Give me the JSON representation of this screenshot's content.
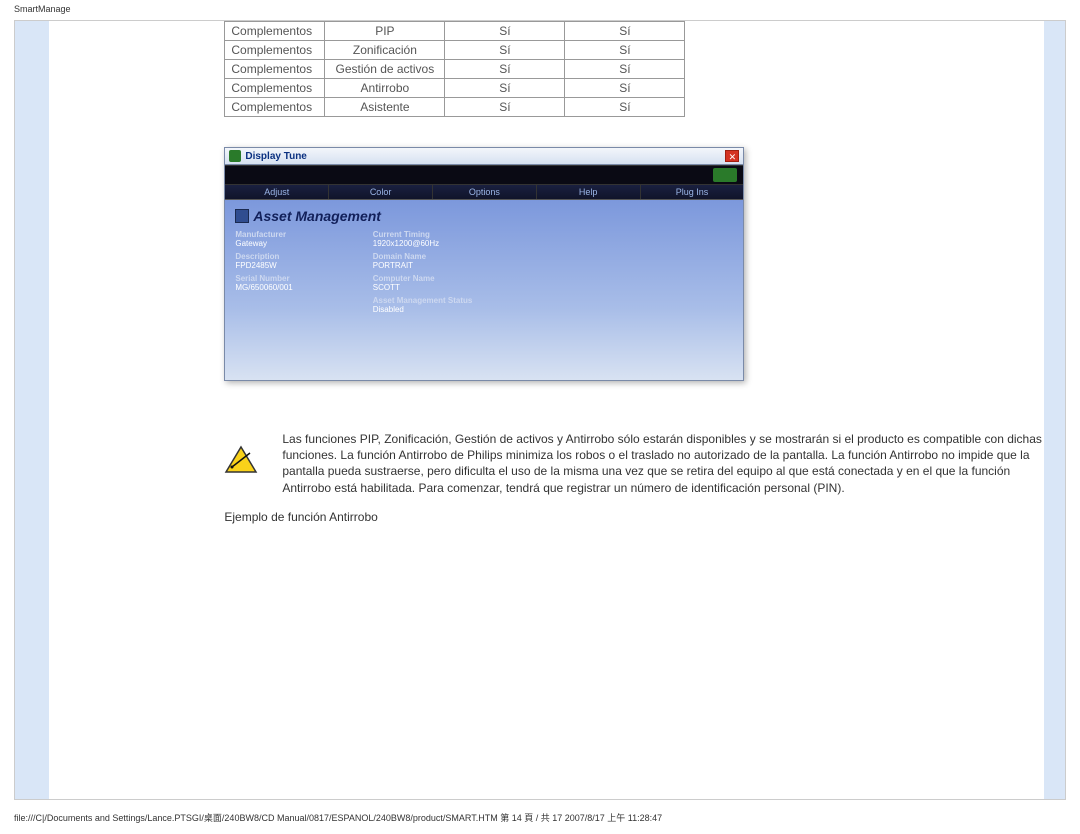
{
  "page_title": "SmartManage",
  "table": {
    "rows": [
      {
        "c1": "Complementos",
        "c2": "PIP",
        "c3": "Sí",
        "c4": "Sí"
      },
      {
        "c1": "Complementos",
        "c2": "Zonificación",
        "c3": "Sí",
        "c4": "Sí"
      },
      {
        "c1": "Complementos",
        "c2": "Gestión de activos",
        "c3": "Sí",
        "c4": "Sí"
      },
      {
        "c1": "Complementos",
        "c2": "Antirrobo",
        "c3": "Sí",
        "c4": "Sí"
      },
      {
        "c1": "Complementos",
        "c2": "Asistente",
        "c3": "Sí",
        "c4": "Sí"
      }
    ]
  },
  "display_tune": {
    "title": "Display Tune",
    "tabs": [
      "Adjust",
      "Color",
      "Options",
      "Help",
      "Plug Ins"
    ],
    "header": "Asset Management",
    "left": [
      {
        "label": "Manufacturer",
        "value": "Gateway"
      },
      {
        "label": "Description",
        "value": "FPD2485W"
      },
      {
        "label": "Serial Number",
        "value": "MG/650060/001"
      }
    ],
    "right": [
      {
        "label": "Current Timing",
        "value": "1920x1200@60Hz"
      },
      {
        "label": "Domain Name",
        "value": "PORTRAIT"
      },
      {
        "label": "Computer Name",
        "value": "SCOTT"
      },
      {
        "label": "Asset Management Status",
        "value": "Disabled"
      }
    ]
  },
  "paragraph": "Las funciones PIP, Zonificación, Gestión de activos y Antirrobo sólo estarán disponibles y se mostrarán si el producto es compatible con dichas funciones. La función Antirrobo de Philips minimiza los robos o el traslado no autorizado de la pantalla. La función Antirrobo no impide que la pantalla pueda sustraerse, pero dificulta el uso de la misma una vez que se retira del equipo al que está conectada y en el que la función Antirrobo está habilitada. Para comenzar, tendrá que registrar un número de identificación personal (PIN).",
  "example_line": "Ejemplo de función Antirrobo",
  "footer": "file:///C|/Documents and Settings/Lance.PTSGI/桌面/240BW8/CD Manual/0817/ESPANOL/240BW8/product/SMART.HTM 第 14 頁 / 共 17 2007/8/17 上午 11:28:47"
}
